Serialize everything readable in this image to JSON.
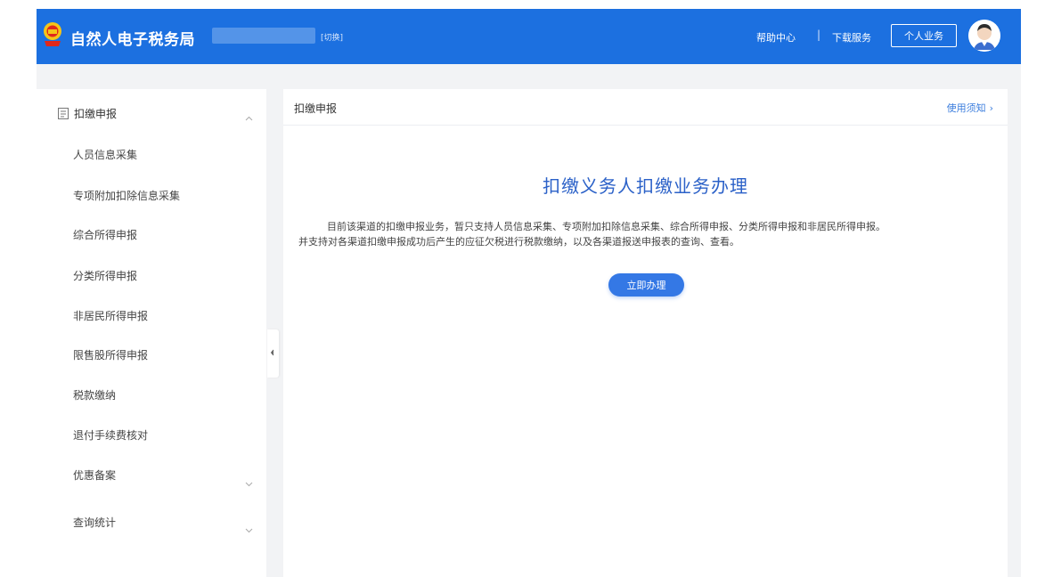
{
  "colors": {
    "header_bg": "#1c70e0",
    "accent": "#3478e5",
    "title": "#2b61c8",
    "link": "#3b7ddd"
  },
  "header": {
    "app_title": "自然人电子税务局",
    "switch_label": "[切换]",
    "help_label": "帮助中心",
    "separator": "|",
    "download_label": "下载服务",
    "personal_label": "个人业务",
    "logo_icon": "tax-emblem-icon",
    "avatar_icon": "user-avatar-icon"
  },
  "sidebar": {
    "group_label": "扣缴申报",
    "group_icon": "document-icon",
    "items": [
      {
        "label": "人员信息采集"
      },
      {
        "label": "专项附加扣除信息采集"
      },
      {
        "label": "综合所得申报"
      },
      {
        "label": "分类所得申报"
      },
      {
        "label": "非居民所得申报"
      },
      {
        "label": "限售股所得申报"
      },
      {
        "label": "税款缴纳"
      },
      {
        "label": "退付手续费核对"
      },
      {
        "label": "优惠备案",
        "has_children": true
      },
      {
        "label": "查询统计",
        "has_children": true
      }
    ]
  },
  "content": {
    "section_title": "扣缴申报",
    "usage_link": "使用须知",
    "main_title": "扣缴义务人扣缴业务办理",
    "desc_line1": "目前该渠道的扣缴申报业务，暂只支持人员信息采集、专项附加扣除信息采集、综合所得申报、分类所得申报和非居民所得申报。",
    "desc_line2": "并支持对各渠道扣缴申报成功后产生的应征欠税进行税款缴纳，以及各渠道报送申报表的查询、查看。",
    "action_label": "立即办理"
  }
}
